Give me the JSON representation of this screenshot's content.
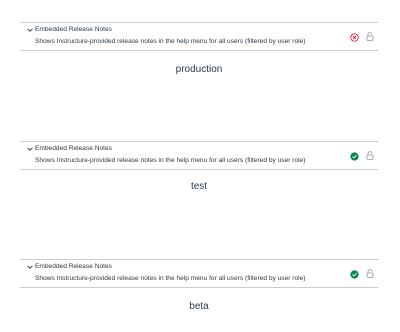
{
  "colors": {
    "text": "#2d3b45",
    "divider": "#c7cdd1",
    "error_red": "#e0061f",
    "success_green": "#0b874b",
    "lock_gray": "#8b969e"
  },
  "panels": [
    {
      "title": "Embedded Release Notes",
      "description": "Shows Instructure-provided release notes in the help menu for all users (filtered by user role)",
      "status_icon": "error-x-circle-icon",
      "environment": "production"
    },
    {
      "title": "Embedded Release Notes",
      "description": "Shows Instructure-provided release notes in the help menu for all users (filtered by user role)",
      "status_icon": "success-check-circle-icon",
      "environment": "test"
    },
    {
      "title": "Embedded Release Notes",
      "description": "Shows Instructure-provided release notes in the help menu for all users (filtered by user role)",
      "status_icon": "success-check-circle-icon",
      "environment": "beta"
    }
  ]
}
